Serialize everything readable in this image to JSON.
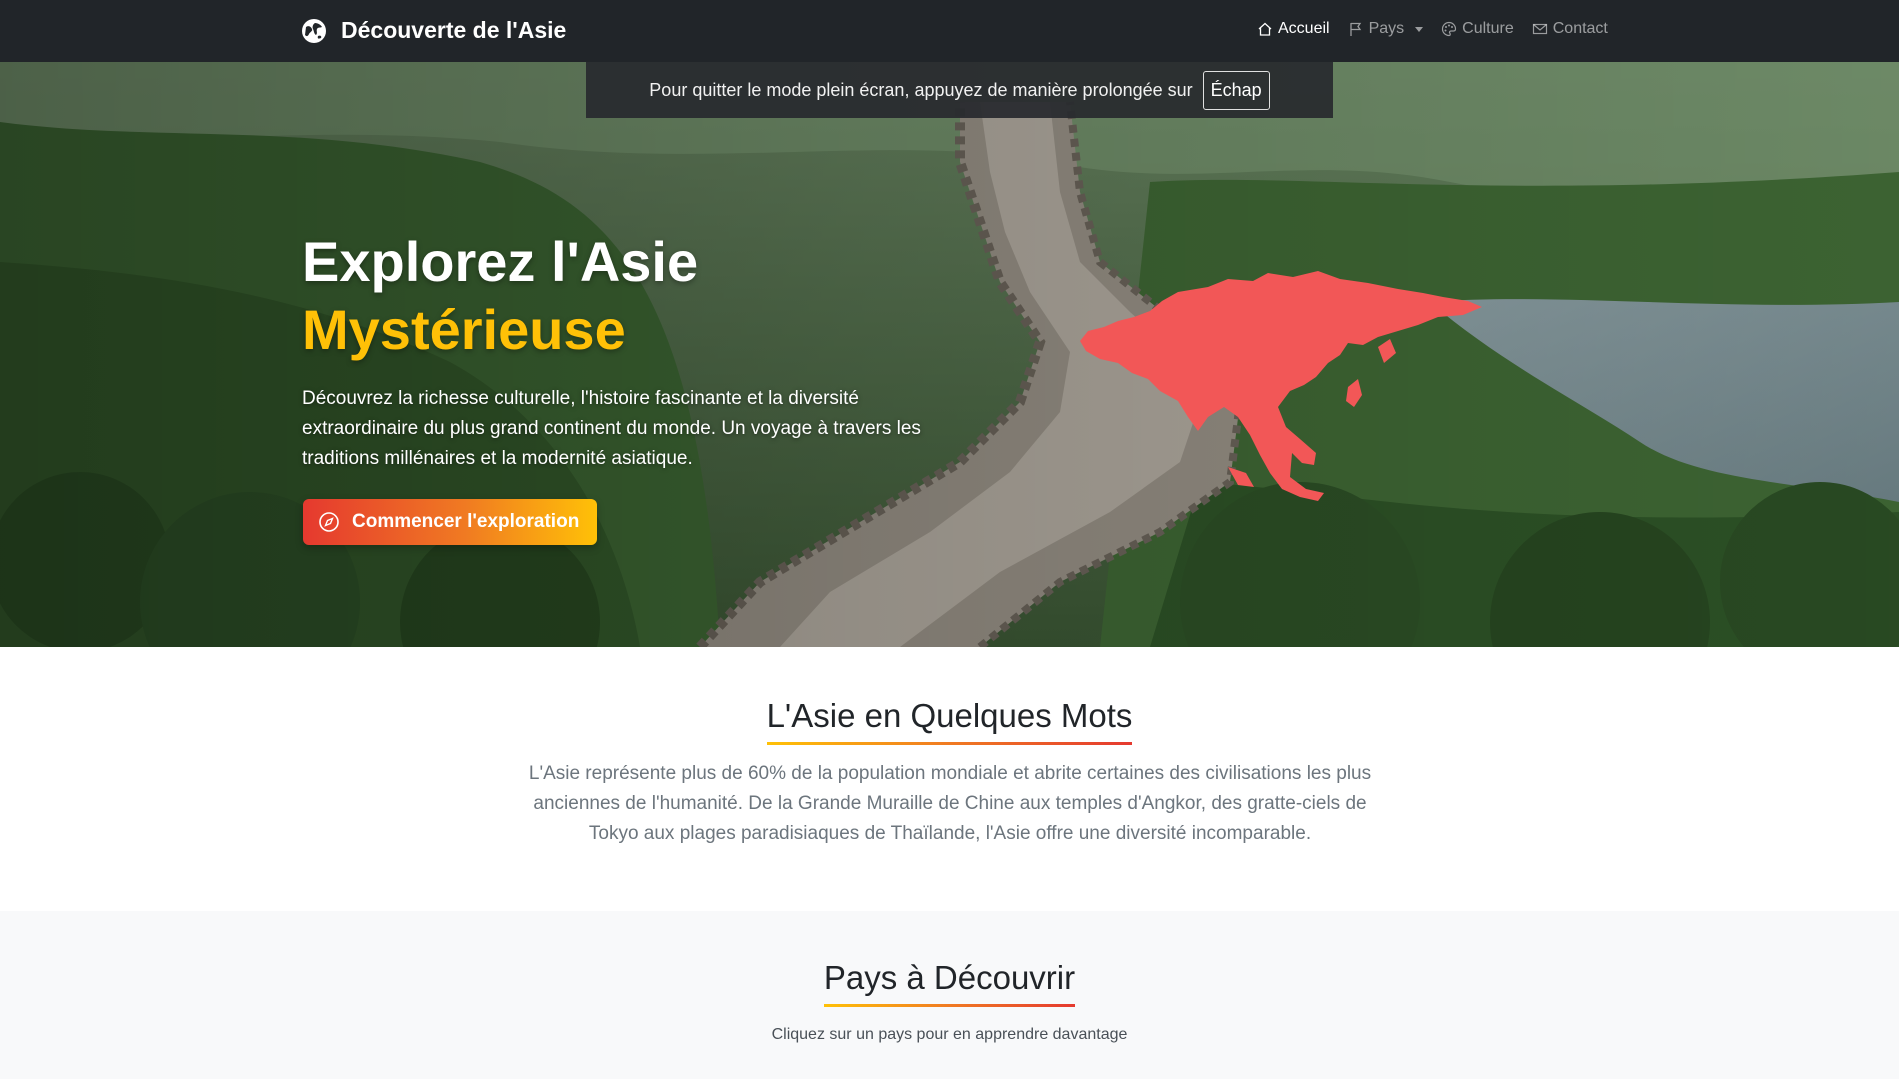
{
  "navbar": {
    "brand": "Découverte de l'Asie",
    "links": [
      {
        "label": "Accueil",
        "icon": "home-icon",
        "active": true
      },
      {
        "label": "Pays",
        "icon": "flag-icon",
        "dropdown": true
      },
      {
        "label": "Culture",
        "icon": "palette-icon"
      },
      {
        "label": "Contact",
        "icon": "envelope-icon"
      }
    ]
  },
  "fullscreen_notice": {
    "text": "Pour quitter le mode plein écran, appuyez de manière prolongée sur",
    "key": "Échap"
  },
  "hero": {
    "title_line1": "Explorez l'Asie",
    "title_line2": "Mystérieuse",
    "description": "Découvrez la richesse culturelle, l'histoire fascinante et la diversité extraordinaire du plus grand continent du monde. Un voyage à travers les traditions millénaires et la modernité asiatique.",
    "cta_label": "Commencer l'exploration",
    "cta_icon": "compass-icon"
  },
  "about": {
    "title": "L'Asie en Quelques Mots",
    "text": "L'Asie représente plus de 60% de la population mondiale et abrite certaines des civilisations les plus anciennes de l'humanité. De la Grande Muraille de Chine aux temples d'Angkor, des gratte-ciels de Tokyo aux plages paradisiaques de Thaïlande, l'Asie offre une diversité incomparable."
  },
  "countries": {
    "title": "Pays à Découvrir",
    "subtitle": "Cliquez sur un pays pour en apprendre davantage"
  },
  "colors": {
    "navbar_bg": "#212529",
    "accent_yellow": "#ffc107",
    "accent_red": "#e5392f",
    "map_red": "#f05252"
  }
}
